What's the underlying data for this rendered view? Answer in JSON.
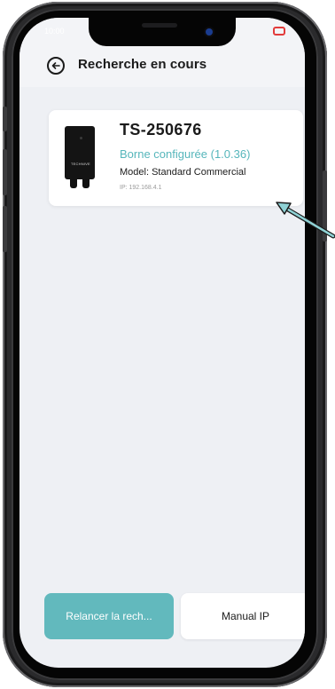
{
  "status_bar": {
    "time": "10:00"
  },
  "header": {
    "title": "Recherche en cours",
    "back_icon": "arrow-left-circle-icon"
  },
  "device_card": {
    "name": "TS-250676",
    "status": "Borne configurée (1.0.36)",
    "model": "Model: Standard Commercial",
    "ip": "IP: 192.168.4.1",
    "brand": "TECHNIVE",
    "status_color": "#56b6bb"
  },
  "actions": {
    "relaunch_label": "Relancer la rech...",
    "manual_ip_label": "Manual IP",
    "relaunch_color": "#62b9bd"
  },
  "annotation": {
    "arrow_color": "#5bb6ba",
    "icon": "pointer-arrow-icon"
  }
}
